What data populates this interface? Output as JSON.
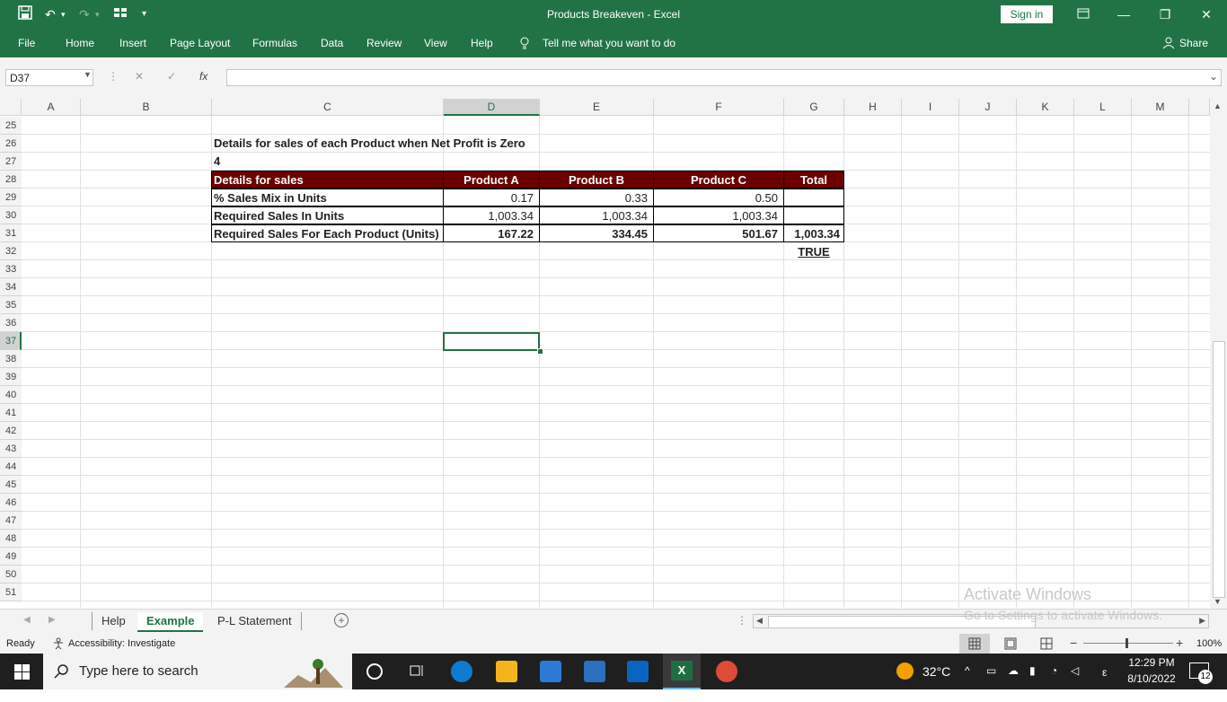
{
  "window": {
    "title": "Products Breakeven  -  Excel",
    "sign_in": "Sign in"
  },
  "quick_access": {
    "save_icon": "save-icon",
    "undo_icon": "undo-icon",
    "redo_icon": "redo-icon"
  },
  "menu": {
    "items": [
      "File",
      "Home",
      "Insert",
      "Page Layout",
      "Formulas",
      "Data",
      "Review",
      "View",
      "Help"
    ],
    "tell_me": "Tell me what you want to do",
    "share": "Share"
  },
  "formula_bar": {
    "name_box": "D37",
    "fx": "fx",
    "content": ""
  },
  "columns": [
    "A",
    "B",
    "C",
    "D",
    "E",
    "F",
    "G",
    "H",
    "I",
    "J",
    "K",
    "L",
    "M"
  ],
  "selected_column": "D",
  "rows": [
    "25",
    "26",
    "27",
    "28",
    "29",
    "30",
    "31",
    "32",
    "33",
    "34",
    "35",
    "36",
    "37",
    "38",
    "39",
    "40",
    "41",
    "42",
    "43",
    "44",
    "45",
    "46",
    "47",
    "48",
    "49",
    "50",
    "51"
  ],
  "selected_row": "37",
  "sheet": {
    "heading": "Details for sales of each Product when Net Profit is Zero",
    "value_4": "4",
    "table": {
      "headers": [
        "Details for sales",
        "Product A",
        "Product B",
        "Product C",
        "Total"
      ],
      "rows": [
        [
          "% Sales Mix in Units",
          "0.17",
          "0.33",
          "0.50",
          ""
        ],
        [
          "Required Sales In Units",
          "1,003.34",
          "1,003.34",
          "1,003.34",
          ""
        ],
        [
          "Required Sales For Each Product (Units)",
          "167.22",
          "334.45",
          "501.67",
          "1,003.34"
        ]
      ],
      "header_color": "#6b0000"
    },
    "check": "TRUE"
  },
  "tabs": [
    "Help",
    "Example",
    "P-L Statement"
  ],
  "active_tab": "Example",
  "status": {
    "ready": "Ready",
    "accessibility": "Accessibility: Investigate",
    "zoom": "100%"
  },
  "watermark": {
    "line1": "Activate Windows",
    "line2": "Go to Settings to activate Windows."
  },
  "taskbar": {
    "search_placeholder": "Type here to search",
    "temperature": "32°C",
    "time": "12:29 PM",
    "date": "8/10/2022",
    "notifications": "12"
  },
  "colors": {
    "accent": "#217346",
    "table_header": "#6b0000"
  }
}
